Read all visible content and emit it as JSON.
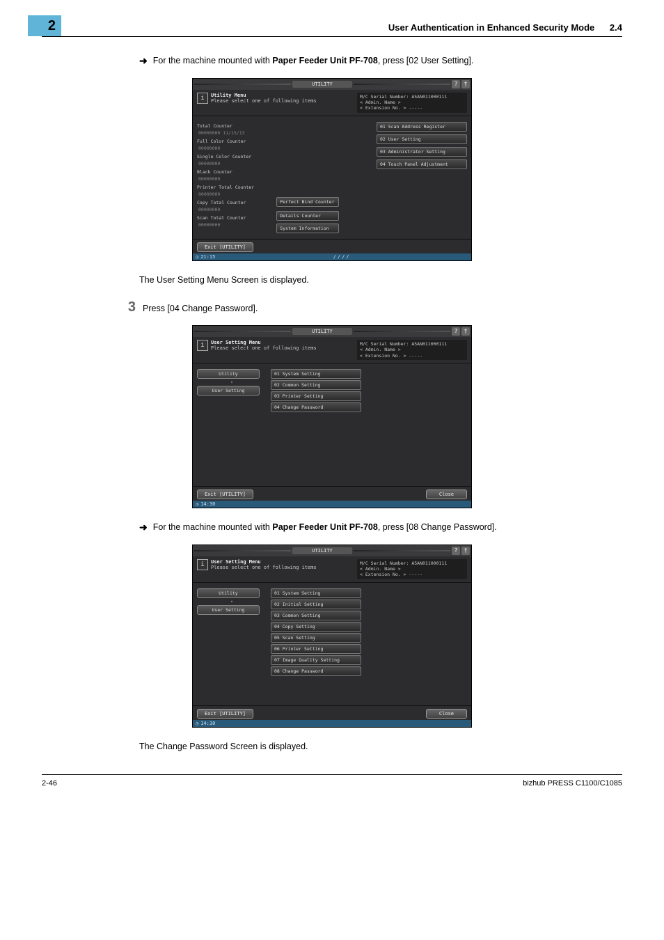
{
  "header": {
    "chapter": "2",
    "title": "User Authentication in Enhanced Security Mode",
    "section": "2.4"
  },
  "content": {
    "bullet1_pre": "For the machine mounted with ",
    "bullet1_bold": "Paper Feeder Unit PF-708",
    "bullet1_post": ", press [02 User Setting].",
    "after_ss1": "The User Setting Menu Screen is displayed.",
    "step3_num": "3",
    "step3_text": "Press [04 Change Password].",
    "bullet2_pre": "For the machine mounted with ",
    "bullet2_bold": "Paper Feeder Unit PF-708",
    "bullet2_post": ", press [08 Change Password].",
    "after_ss3": "The Change Password Screen is displayed."
  },
  "shared_panel": {
    "tab_label": "UTILITY",
    "serial": "M/C Serial Number: A5AN011000111",
    "admin": "< Admin. Name >",
    "ext": "< Extension No. >  -----",
    "exit": "Exit [UTILITY]",
    "close": "Close"
  },
  "ss1": {
    "title": "Utility Menu",
    "subtitle": "Please select one of following items",
    "time": "21:15",
    "status_center": "////",
    "counters": {
      "total": "Total Counter",
      "total_val": "00000000    11/15/13",
      "full_color": "Full Color Counter",
      "single_color": "Single Color Counter",
      "black": "Black Counter",
      "printer_total": "Printer Total Counter",
      "copy_total": "Copy Total Counter",
      "scan_total": "Scan Total Counter",
      "zeros": "00000000"
    },
    "bottom_btns": {
      "perfect": "Perfect Bind Counter",
      "details": "Details Counter",
      "sysinfo": "System Information"
    },
    "right_menu": {
      "b1": "01 Scan Address Register",
      "b2": "02 User Setting",
      "b3": "03 Administrator Setting",
      "b4": "04 Touch Panel Adjustment"
    }
  },
  "ss2": {
    "title": "User Setting Menu",
    "subtitle": "Please select one of following items",
    "time": "14:30",
    "bc_utility": "Utility",
    "bc_user": "User Setting",
    "mid": {
      "b1": "01 System Setting",
      "b2": "02 Common Setting",
      "b3": "03 Printer Setting",
      "b4": "04 Change Password"
    }
  },
  "ss3": {
    "title": "User Setting Menu",
    "subtitle": "Please select one of following items",
    "time": "14:30",
    "bc_utility": "Utility",
    "bc_user": "User Setting",
    "mid": {
      "b1": "01 System Setting",
      "b2": "02 Initial Setting",
      "b3": "03 Common Setting",
      "b4": "04 Copy Setting",
      "b5": "05 Scan Setting",
      "b6": "06 Printer Setting",
      "b7": "07 Image Quality Setting",
      "b8": "08 Change Password"
    }
  },
  "footer": {
    "left": "2-46",
    "right": "bizhub PRESS C1100/C1085"
  }
}
